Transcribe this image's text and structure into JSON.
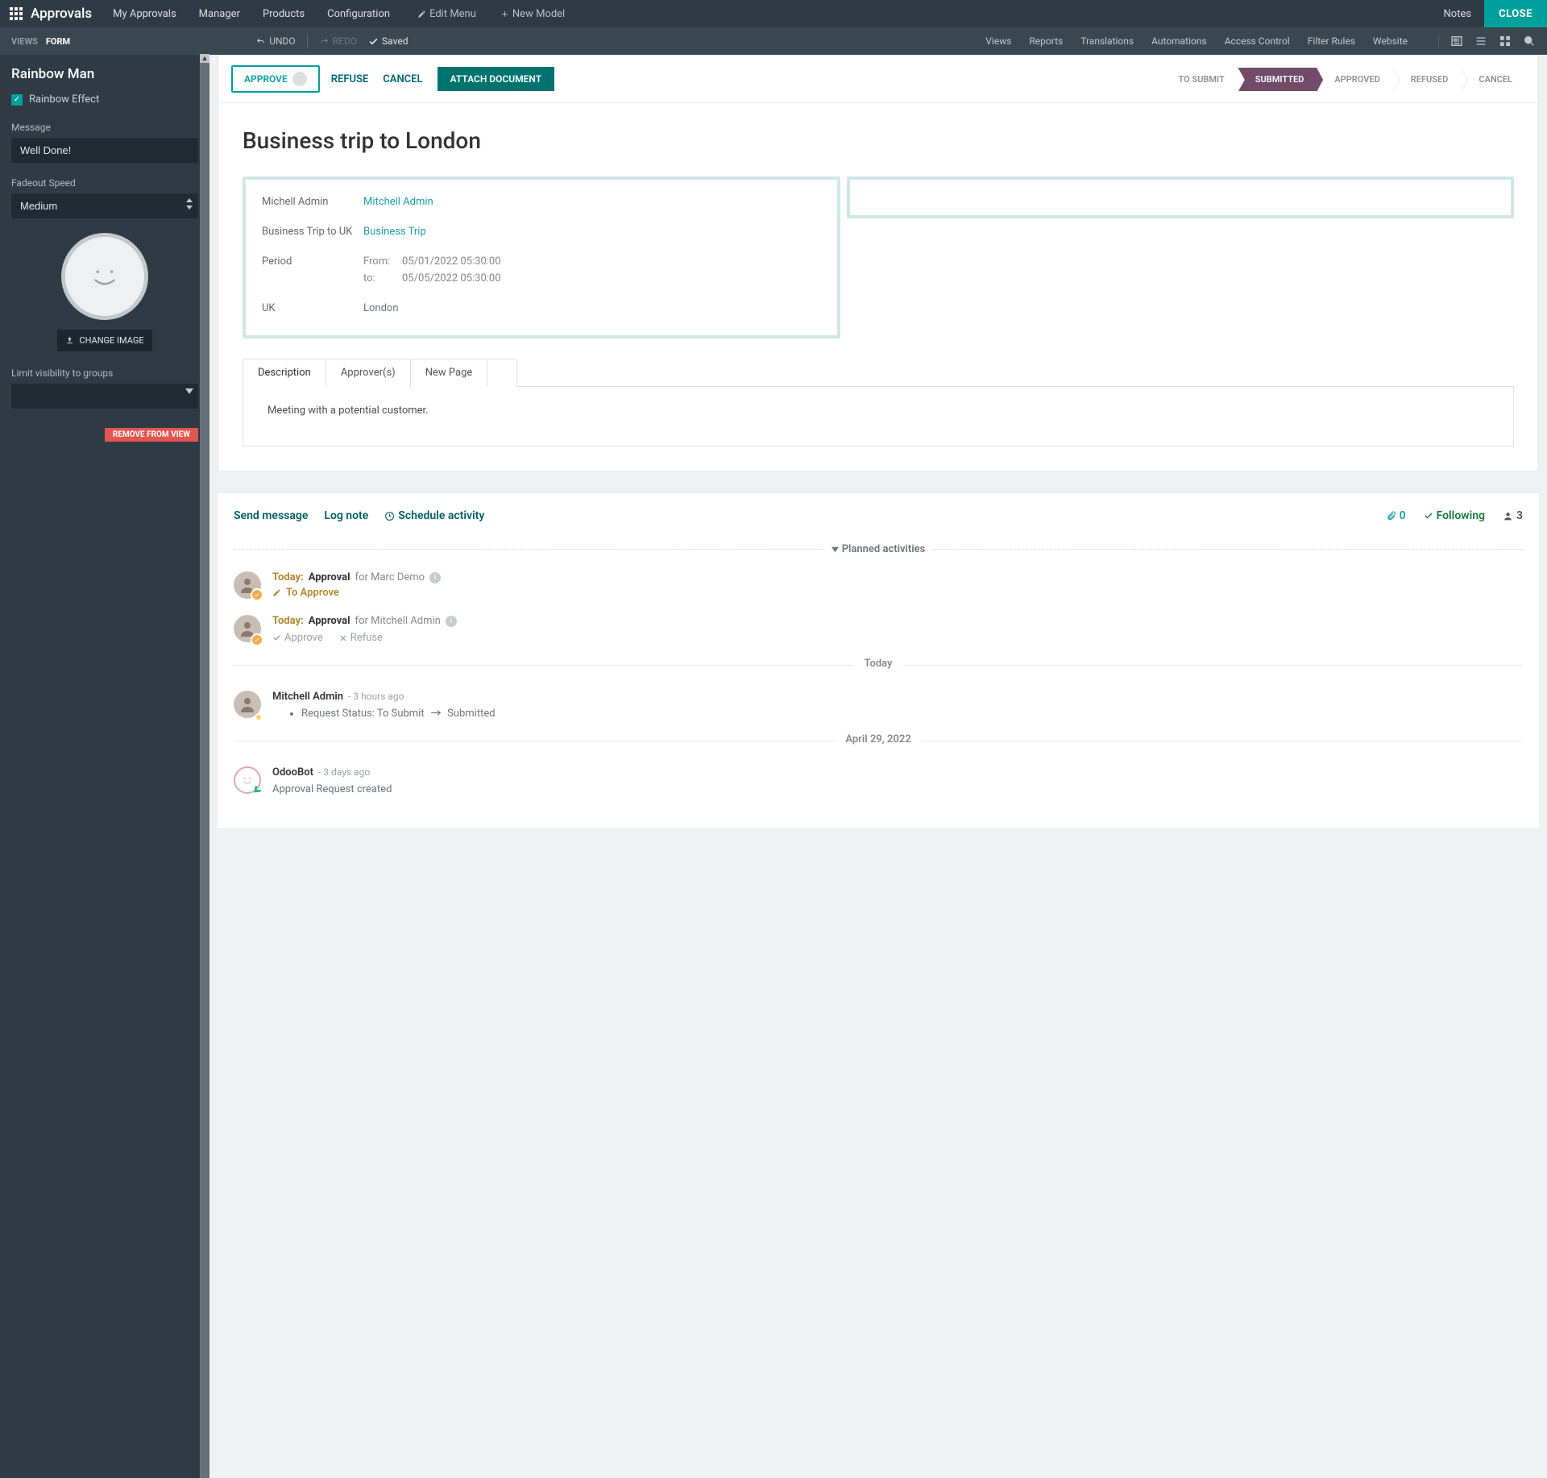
{
  "topbar": {
    "brand": "Approvals",
    "menu": [
      "My Approvals",
      "Manager",
      "Products",
      "Configuration"
    ],
    "edit_menu": "Edit Menu",
    "new_model": "New Model",
    "notes": "Notes",
    "close": "CLOSE"
  },
  "toolbar": {
    "views_label": "VIEWS",
    "form_label": "FORM",
    "undo": "UNDO",
    "redo": "REDO",
    "saved": "Saved",
    "right": [
      "Views",
      "Reports",
      "Translations",
      "Automations",
      "Access Control",
      "Filter Rules",
      "Website"
    ]
  },
  "sidebar": {
    "title": "Rainbow Man",
    "rainbow_effect": "Rainbow Effect",
    "message_label": "Message",
    "message_value": "Well Done!",
    "fadeout_label": "Fadeout Speed",
    "fadeout_value": "Medium",
    "change_image": "CHANGE IMAGE",
    "limit_visibility": "Limit visibility to groups",
    "remove": "REMOVE FROM VIEW"
  },
  "form": {
    "approve": "APPROVE",
    "refuse": "REFUSE",
    "cancel": "CANCEL",
    "attach": "ATTACH DOCUMENT",
    "statuses": [
      "TO SUBMIT",
      "SUBMITTED",
      "APPROVED",
      "REFUSED",
      "CANCEL"
    ],
    "active_status": "SUBMITTED",
    "title": "Business trip to London",
    "f1_label": "Michell Admin",
    "f1_value": "Mitchell Admin",
    "f2_label": "Business Trip to UK",
    "f2_value": "Business Trip",
    "period_label": "Period",
    "period_from_label": "From:",
    "period_from_value": "05/01/2022 05:30:00",
    "period_to_label": "to:",
    "period_to_value": "05/05/2022 05:30:00",
    "f4_label": "UK",
    "f4_value": "London",
    "tabs": [
      "Description",
      "Approver(s)",
      "New Page"
    ],
    "description": "Meeting with a potential customer."
  },
  "chatter": {
    "send": "Send message",
    "log": "Log note",
    "schedule": "Schedule activity",
    "attach_count": "0",
    "following": "Following",
    "followers": "3",
    "planned": "Planned activities",
    "today_label": "Today:",
    "approval_label": "Approval",
    "for_marc": "for Marc Demo",
    "to_approve": "To Approve",
    "for_mitchell": "for Mitchell Admin",
    "approve_action": "Approve",
    "refuse_action": "Refuse",
    "today_sep": "Today",
    "msg1_author": "Mitchell Admin",
    "msg1_time": "- 3 hours ago",
    "msg1_body_pre": "Request Status: To Submit",
    "msg1_body_post": "Submitted",
    "date2": "April 29, 2022",
    "msg2_author": "OdooBot",
    "msg2_time": "- 3 days ago",
    "msg2_body": "Approval Request created"
  }
}
